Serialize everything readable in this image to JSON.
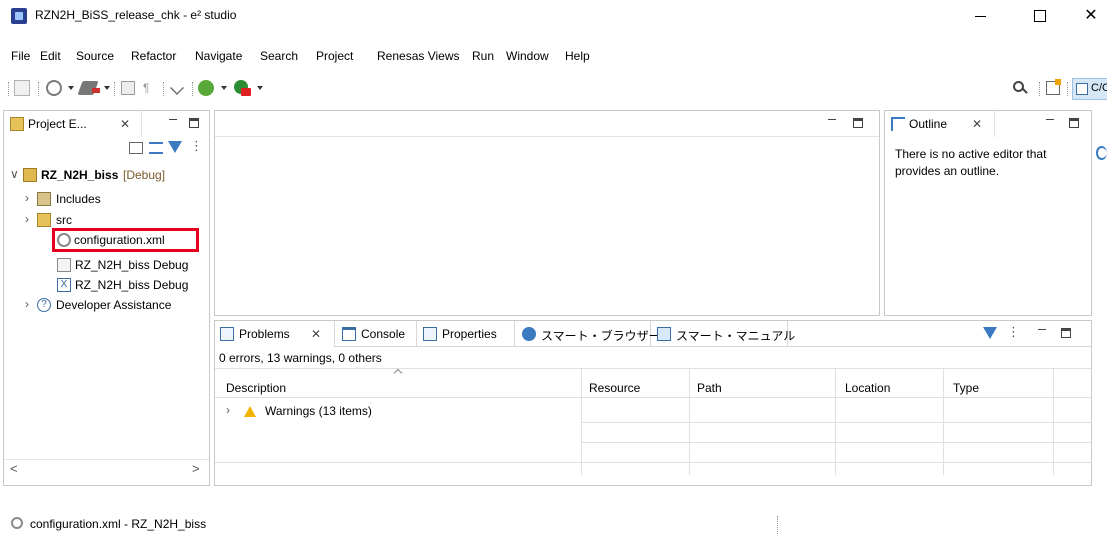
{
  "window": {
    "title": "RZN2H_BiSS_release_chk - e² studio",
    "minimize_glyph": "",
    "maximize_glyph": "",
    "close_glyph": "✕"
  },
  "menu": [
    "File",
    "Edit",
    "Source",
    "Refactor",
    "Navigate",
    "Search",
    "Project",
    "Renesas Views",
    "Run",
    "Window",
    "Help"
  ],
  "toolbar": {
    "perspective_label": "C/C++"
  },
  "project_explorer": {
    "tab_label": "Project E...",
    "close_glyph": "✕",
    "tree": [
      {
        "label": "RZ_N2H_biss",
        "suffix": " [Debug]",
        "arrow": "∨",
        "bold": true
      },
      {
        "label": "Includes",
        "arrow": "›"
      },
      {
        "label": "src",
        "arrow": "›"
      },
      {
        "label": "configuration.xml",
        "arrow": "",
        "selected": true
      },
      {
        "label": "RZ_N2H_biss Debug",
        "arrow": ""
      },
      {
        "label": "RZ_N2H_biss Debug",
        "arrow": ""
      },
      {
        "label": "Developer Assistance",
        "arrow": "›"
      }
    ],
    "scroll_left": "<",
    "scroll_right": ">"
  },
  "outline": {
    "tab_label": "Outline",
    "close_glyph": "✕",
    "message": "There is no active editor that provides an outline."
  },
  "bottom_panel": {
    "tabs": [
      {
        "label": "Problems",
        "icon": "problems-icon",
        "close_glyph": "✕",
        "active": true
      },
      {
        "label": "Console",
        "icon": "console-icon"
      },
      {
        "label": "Properties",
        "icon": "properties-icon"
      },
      {
        "label": "スマート・ブラウザー",
        "icon": "smart-browser-icon"
      },
      {
        "label": "スマート・マニュアル",
        "icon": "smart-manual-icon"
      }
    ],
    "summary": "0 errors, 13 warnings, 0 others",
    "columns": [
      "Description",
      "Resource",
      "Path",
      "Location",
      "Type"
    ],
    "rows": [
      {
        "arrow": "›",
        "label": "Warnings (13 items)"
      }
    ]
  },
  "statusbar": {
    "text": "configuration.xml - RZ_N2H_biss"
  },
  "colors": {
    "selection_highlight": "#e8001e",
    "warning_yellow": "#f0b400"
  }
}
